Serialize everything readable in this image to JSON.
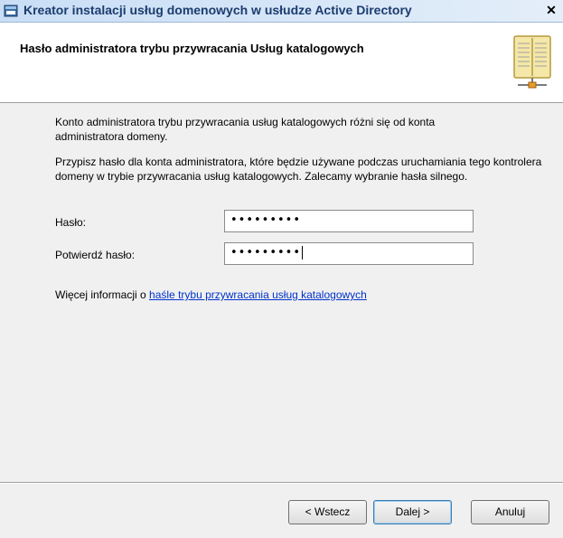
{
  "window": {
    "title": "Kreator instalacji usług domenowych w usłudze Active Directory",
    "close_glyph": "✕"
  },
  "header": {
    "heading": "Hasło administratora trybu przywracania Usług katalogowych",
    "icon": "book-icon"
  },
  "content": {
    "paragraph1": "Konto administratora trybu przywracania usług katalogowych różni się od konta administratora domeny.",
    "paragraph2": "Przypisz hasło dla konta administratora, które będzie używane podczas uruchamiania tego kontrolera domeny w trybie przywracania usług katalogowych. Zalecamy wybranie hasła silnego.",
    "password_label": "Hasło:",
    "password_value": "•••••••••",
    "confirm_label": "Potwierdź hasło:",
    "confirm_value": "•••••••••",
    "more_info_prefix": "Więcej informacji o",
    "more_info_link": "haśle trybu przywracania usług katalogowych"
  },
  "buttons": {
    "back": "< Wstecz",
    "next": "Dalej >",
    "cancel": "Anuluj"
  }
}
